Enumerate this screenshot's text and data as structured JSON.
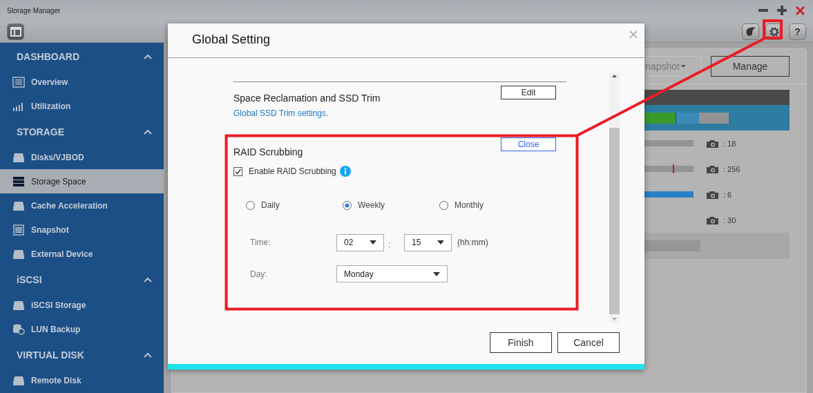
{
  "app": {
    "title": "Storage Manager",
    "help_label": "?"
  },
  "sidebar": {
    "sections": [
      {
        "title": "DASHBOARD",
        "expanded": true,
        "items": [
          {
            "label": "Overview",
            "selected": false
          },
          {
            "label": "Utilization",
            "selected": false
          }
        ]
      },
      {
        "title": "STORAGE",
        "expanded": true,
        "items": [
          {
            "label": "Disks/VJBOD",
            "selected": false
          },
          {
            "label": "Storage Space",
            "selected": true
          },
          {
            "label": "Cache Acceleration",
            "selected": false
          },
          {
            "label": "Snapshot",
            "selected": false
          },
          {
            "label": "External Device",
            "selected": false
          }
        ]
      },
      {
        "title": "iSCSI",
        "expanded": true,
        "items": [
          {
            "label": "iSCSI Storage",
            "selected": false
          },
          {
            "label": "LUN Backup",
            "selected": false
          }
        ]
      },
      {
        "title": "VIRTUAL DISK",
        "expanded": true,
        "items": [
          {
            "label": "Remote Disk",
            "selected": false
          }
        ]
      }
    ]
  },
  "background": {
    "buttons": [
      "napshot",
      "Manage"
    ],
    "rows": [
      {
        "kind": "plain",
        "count": ": 18"
      },
      {
        "kind": "marked",
        "count": ": 256"
      },
      {
        "kind": "filled",
        "count": ": 6"
      },
      {
        "kind": "empty",
        "count": ": 30"
      }
    ]
  },
  "dialog": {
    "title": "Global Setting",
    "trim": {
      "title": "Space Reclamation and SSD Trim",
      "button": "Edit",
      "expanded": false,
      "link": "Global SSD Trim settings."
    },
    "scrubbing": {
      "title": "RAID Scrubbing",
      "button": "Close",
      "expanded": true,
      "checkbox": {
        "label": "Enable RAID Scrubbing",
        "checked": true
      },
      "frequency": [
        {
          "label": "Daily",
          "selected": false
        },
        {
          "label": "Weekly",
          "selected": true
        },
        {
          "label": "Monthly",
          "selected": false
        }
      ],
      "time": {
        "label": "Time:",
        "hour": "02",
        "separator": ":",
        "minute": "15",
        "format": "(hh:mm)"
      },
      "day": {
        "label": "Day:",
        "value": "Monday"
      }
    },
    "buttons": [
      "Finish",
      "Cancel"
    ]
  }
}
